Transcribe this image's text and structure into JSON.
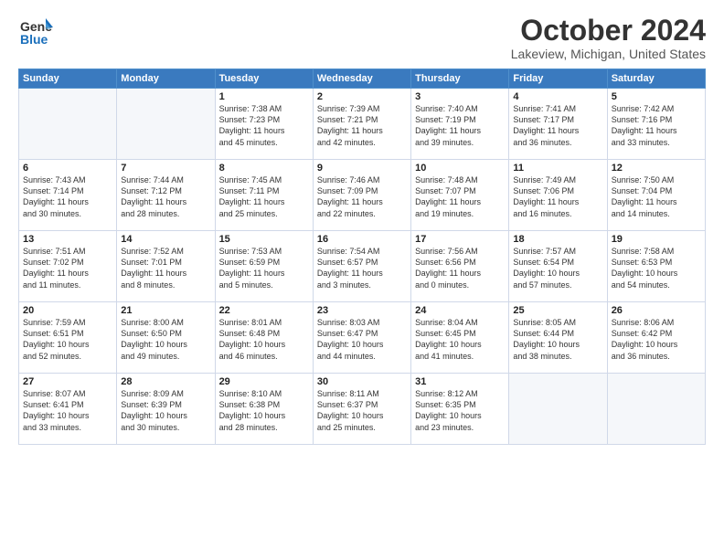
{
  "logo": {
    "general": "General",
    "blue": "Blue"
  },
  "title": "October 2024",
  "subtitle": "Lakeview, Michigan, United States",
  "days_of_week": [
    "Sunday",
    "Monday",
    "Tuesday",
    "Wednesday",
    "Thursday",
    "Friday",
    "Saturday"
  ],
  "weeks": [
    [
      {
        "day": "",
        "detail": ""
      },
      {
        "day": "",
        "detail": ""
      },
      {
        "day": "1",
        "detail": "Sunrise: 7:38 AM\nSunset: 7:23 PM\nDaylight: 11 hours\nand 45 minutes."
      },
      {
        "day": "2",
        "detail": "Sunrise: 7:39 AM\nSunset: 7:21 PM\nDaylight: 11 hours\nand 42 minutes."
      },
      {
        "day": "3",
        "detail": "Sunrise: 7:40 AM\nSunset: 7:19 PM\nDaylight: 11 hours\nand 39 minutes."
      },
      {
        "day": "4",
        "detail": "Sunrise: 7:41 AM\nSunset: 7:17 PM\nDaylight: 11 hours\nand 36 minutes."
      },
      {
        "day": "5",
        "detail": "Sunrise: 7:42 AM\nSunset: 7:16 PM\nDaylight: 11 hours\nand 33 minutes."
      }
    ],
    [
      {
        "day": "6",
        "detail": "Sunrise: 7:43 AM\nSunset: 7:14 PM\nDaylight: 11 hours\nand 30 minutes."
      },
      {
        "day": "7",
        "detail": "Sunrise: 7:44 AM\nSunset: 7:12 PM\nDaylight: 11 hours\nand 28 minutes."
      },
      {
        "day": "8",
        "detail": "Sunrise: 7:45 AM\nSunset: 7:11 PM\nDaylight: 11 hours\nand 25 minutes."
      },
      {
        "day": "9",
        "detail": "Sunrise: 7:46 AM\nSunset: 7:09 PM\nDaylight: 11 hours\nand 22 minutes."
      },
      {
        "day": "10",
        "detail": "Sunrise: 7:48 AM\nSunset: 7:07 PM\nDaylight: 11 hours\nand 19 minutes."
      },
      {
        "day": "11",
        "detail": "Sunrise: 7:49 AM\nSunset: 7:06 PM\nDaylight: 11 hours\nand 16 minutes."
      },
      {
        "day": "12",
        "detail": "Sunrise: 7:50 AM\nSunset: 7:04 PM\nDaylight: 11 hours\nand 14 minutes."
      }
    ],
    [
      {
        "day": "13",
        "detail": "Sunrise: 7:51 AM\nSunset: 7:02 PM\nDaylight: 11 hours\nand 11 minutes."
      },
      {
        "day": "14",
        "detail": "Sunrise: 7:52 AM\nSunset: 7:01 PM\nDaylight: 11 hours\nand 8 minutes."
      },
      {
        "day": "15",
        "detail": "Sunrise: 7:53 AM\nSunset: 6:59 PM\nDaylight: 11 hours\nand 5 minutes."
      },
      {
        "day": "16",
        "detail": "Sunrise: 7:54 AM\nSunset: 6:57 PM\nDaylight: 11 hours\nand 3 minutes."
      },
      {
        "day": "17",
        "detail": "Sunrise: 7:56 AM\nSunset: 6:56 PM\nDaylight: 11 hours\nand 0 minutes."
      },
      {
        "day": "18",
        "detail": "Sunrise: 7:57 AM\nSunset: 6:54 PM\nDaylight: 10 hours\nand 57 minutes."
      },
      {
        "day": "19",
        "detail": "Sunrise: 7:58 AM\nSunset: 6:53 PM\nDaylight: 10 hours\nand 54 minutes."
      }
    ],
    [
      {
        "day": "20",
        "detail": "Sunrise: 7:59 AM\nSunset: 6:51 PM\nDaylight: 10 hours\nand 52 minutes."
      },
      {
        "day": "21",
        "detail": "Sunrise: 8:00 AM\nSunset: 6:50 PM\nDaylight: 10 hours\nand 49 minutes."
      },
      {
        "day": "22",
        "detail": "Sunrise: 8:01 AM\nSunset: 6:48 PM\nDaylight: 10 hours\nand 46 minutes."
      },
      {
        "day": "23",
        "detail": "Sunrise: 8:03 AM\nSunset: 6:47 PM\nDaylight: 10 hours\nand 44 minutes."
      },
      {
        "day": "24",
        "detail": "Sunrise: 8:04 AM\nSunset: 6:45 PM\nDaylight: 10 hours\nand 41 minutes."
      },
      {
        "day": "25",
        "detail": "Sunrise: 8:05 AM\nSunset: 6:44 PM\nDaylight: 10 hours\nand 38 minutes."
      },
      {
        "day": "26",
        "detail": "Sunrise: 8:06 AM\nSunset: 6:42 PM\nDaylight: 10 hours\nand 36 minutes."
      }
    ],
    [
      {
        "day": "27",
        "detail": "Sunrise: 8:07 AM\nSunset: 6:41 PM\nDaylight: 10 hours\nand 33 minutes."
      },
      {
        "day": "28",
        "detail": "Sunrise: 8:09 AM\nSunset: 6:39 PM\nDaylight: 10 hours\nand 30 minutes."
      },
      {
        "day": "29",
        "detail": "Sunrise: 8:10 AM\nSunset: 6:38 PM\nDaylight: 10 hours\nand 28 minutes."
      },
      {
        "day": "30",
        "detail": "Sunrise: 8:11 AM\nSunset: 6:37 PM\nDaylight: 10 hours\nand 25 minutes."
      },
      {
        "day": "31",
        "detail": "Sunrise: 8:12 AM\nSunset: 6:35 PM\nDaylight: 10 hours\nand 23 minutes."
      },
      {
        "day": "",
        "detail": ""
      },
      {
        "day": "",
        "detail": ""
      }
    ]
  ]
}
